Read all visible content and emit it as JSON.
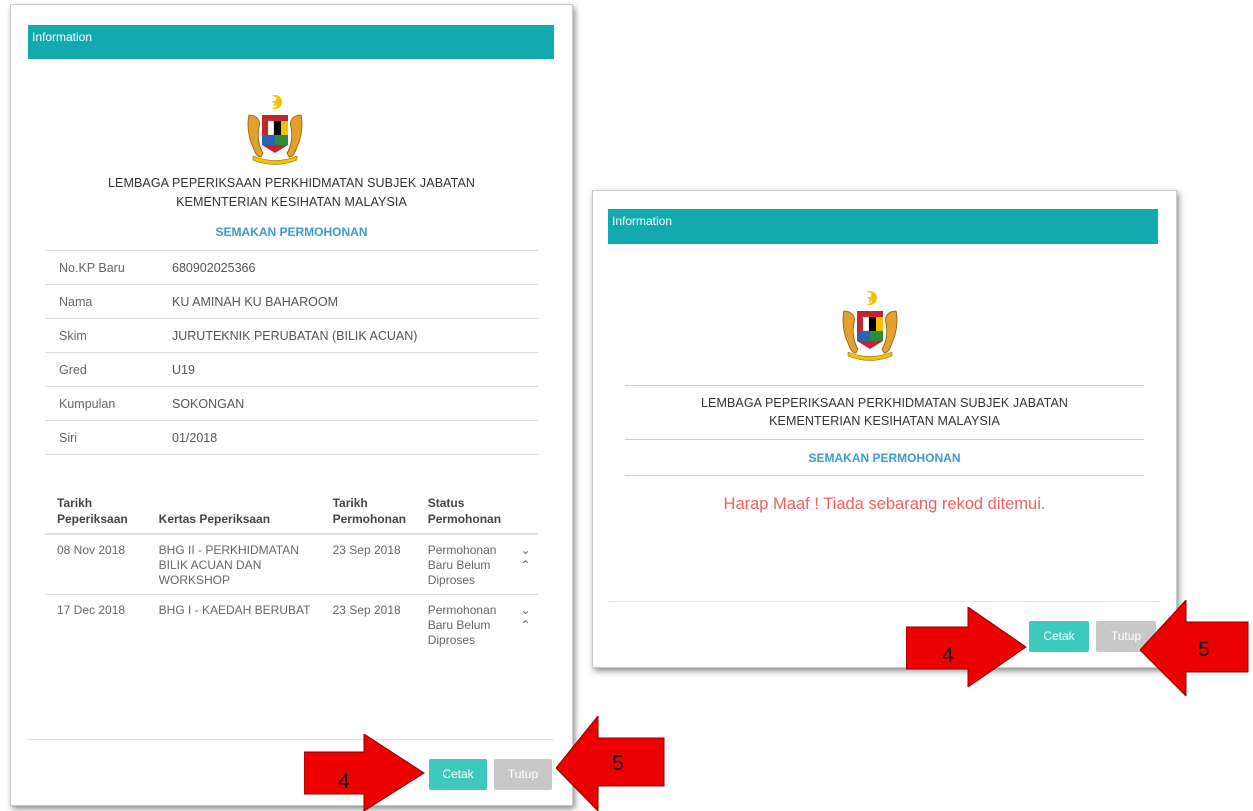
{
  "left_modal": {
    "header_title": "Information",
    "org_line_1": "LEMBAGA PEPERIKSAAN PERKHIDMATAN SUBJEK JABATAN",
    "org_line_2": "KEMENTERIAN KESIHATAN MALAYSIA",
    "section_title": "SEMAKAN PERMOHONAN",
    "info": [
      {
        "label": "No.KP Baru",
        "value": "680902025366"
      },
      {
        "label": "Nama",
        "value": "KU AMINAH KU BAHAROOM"
      },
      {
        "label": "Skim",
        "value": "JURUTEKNIK PERUBATAN (BILIK ACUAN)"
      },
      {
        "label": "Gred",
        "value": "U19"
      },
      {
        "label": "Kumpulan",
        "value": "SOKONGAN"
      },
      {
        "label": "Siri",
        "value": "01/2018"
      }
    ],
    "exam_headers": {
      "date_1": "Tarikh",
      "date_2": "Peperiksaan",
      "paper": "Kertas Peperiksaan",
      "applied_1": "Tarikh",
      "applied_2": "Permohonan",
      "status_1": "Status",
      "status_2": "Permohonan"
    },
    "exams": [
      {
        "date": "08 Nov 2018",
        "paper_1": "BHG II - PERKHIDMATAN",
        "paper_2": "BILIK ACUAN DAN",
        "paper_3": "WORKSHOP",
        "applied": "23 Sep 2018",
        "status_1": "Permohonan",
        "status_2": "Baru Belum",
        "status_3": "Diproses",
        "chevron_down": "⌄",
        "chevron_up": "⌃"
      },
      {
        "date": "17 Dec 2018",
        "paper_1": "BHG I - KAEDAH BERUBAT",
        "paper_2": "",
        "paper_3": "",
        "applied": "23 Sep 2018",
        "status_1": "Permohonan",
        "status_2": "Baru Belum",
        "status_3": "Diproses",
        "chevron_down": "⌄",
        "chevron_up": "⌃"
      }
    ],
    "print_label": "Cetak",
    "close_label": "Tutup"
  },
  "right_modal": {
    "header_title": "Information",
    "org_line_1": "LEMBAGA PEPERIKSAAN PERKHIDMATAN SUBJEK JABATAN",
    "org_line_2": "KEMENTERIAN KESIHATAN MALAYSIA",
    "section_title": "SEMAKAN PERMOHONAN",
    "message": "Harap Maaf ! Tiada sebarang rekod ditemui.",
    "print_label": "Cetak",
    "close_label": "Tutup"
  },
  "callouts": {
    "print_step": "4",
    "close_step": "5",
    "arrow_color": "#ee0000"
  },
  "colors": {
    "header": "#12aaaf",
    "print_button": "#3ec9bd",
    "close_button": "#c8c8c8",
    "section_title": "#3b9bd5",
    "error_message": "#f0605d"
  },
  "icons": {
    "crest": "malaysia-coat-of-arms-icon"
  }
}
